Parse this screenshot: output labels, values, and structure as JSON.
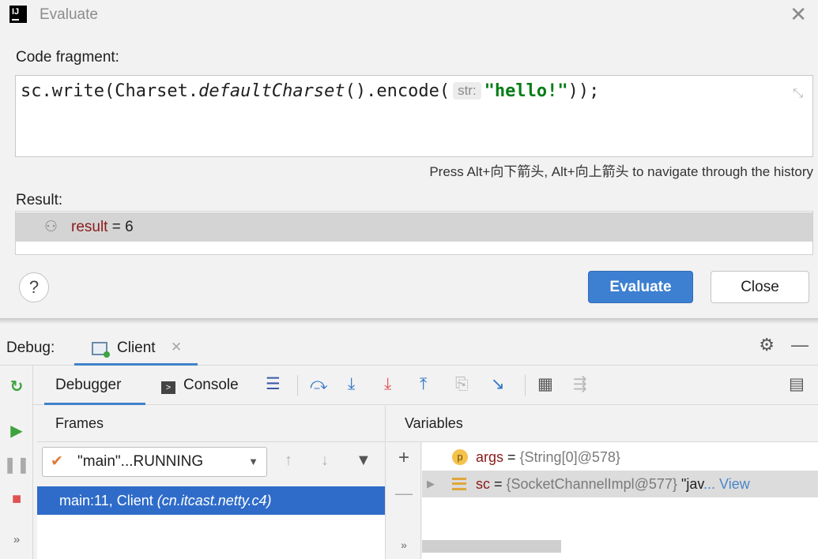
{
  "dialog": {
    "title": "Evaluate",
    "code_label": "Code fragment:",
    "code": {
      "part1": "sc.write(Charset.",
      "part2": "defaultCharset",
      "part3": "().encode(",
      "hint": "str:",
      "string": "\"hello!\"",
      "part4": "));"
    },
    "history_hint": "Press Alt+向下箭头, Alt+向上箭头 to navigate through the history",
    "result_label": "Result:",
    "result": {
      "name": "result",
      "eq": " = ",
      "value": "6"
    },
    "help_label": "?",
    "evaluate_label": "Evaluate",
    "close_label": "Close"
  },
  "debug": {
    "label": "Debug:",
    "session_tab": "Client",
    "tabs": {
      "debugger": "Debugger",
      "console": "Console"
    },
    "frames": {
      "title": "Frames",
      "thread": "\"main\"...RUNNING",
      "frame": {
        "location": "main:11, Client ",
        "package": "(cn.itcast.netty.c4)"
      }
    },
    "variables": {
      "title": "Variables",
      "items": [
        {
          "name": "args",
          "value": "{String[0]@578}",
          "extra": ""
        },
        {
          "name": "sc",
          "value": "{SocketChannelImpl@577}",
          "extra": " \"jav",
          "link": "... View"
        }
      ]
    }
  },
  "icons": [
    "app-logo-icon",
    "close-icon",
    "collapse-icon",
    "watch-icon",
    "help-icon",
    "client-icon",
    "gear-icon",
    "minimize-icon",
    "rerun-icon",
    "resume-icon",
    "pause-icon",
    "stop-icon",
    "more-icon",
    "console-icon",
    "layout-icon",
    "step-over-icon",
    "step-into-icon",
    "force-step-into-icon",
    "step-out-icon",
    "drop-frame-icon",
    "run-to-cursor-icon",
    "evaluate-expression-icon",
    "trace-icon",
    "settings-icon",
    "check-icon",
    "chevron-down-icon",
    "arrow-up-icon",
    "arrow-down-icon",
    "filter-icon",
    "add-watch-icon",
    "remove-icon",
    "expand-icon",
    "field-icon"
  ],
  "colors": {
    "accent": "#3d7fd1",
    "selection": "#2f6cc9",
    "string": "#067d17",
    "var_name": "#8b1a1a"
  }
}
